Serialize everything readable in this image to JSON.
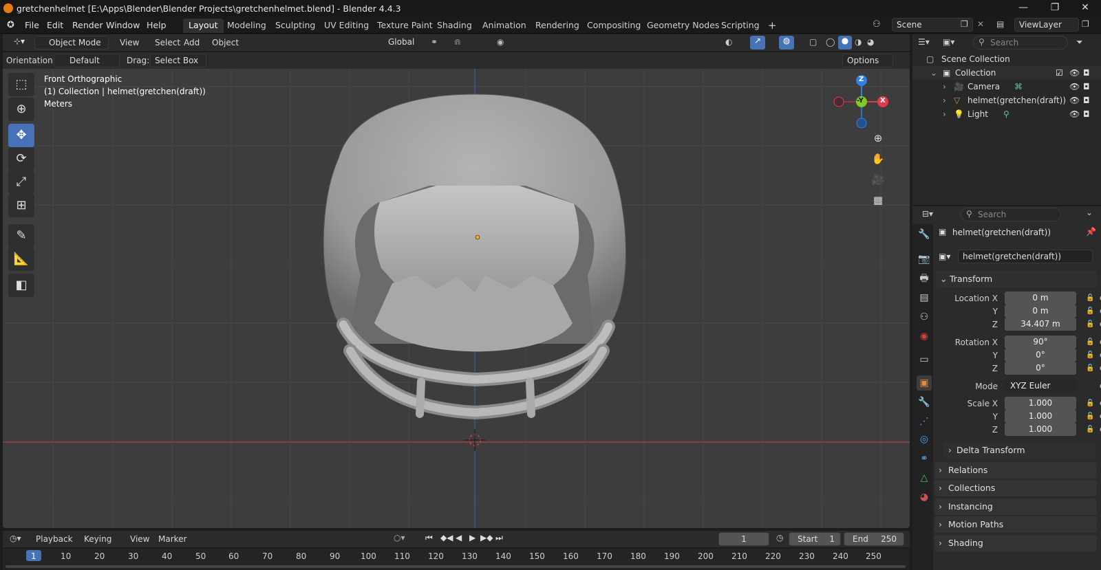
{
  "window": {
    "title": "gretchenhelmet [E:\\Apps\\Blender\\Blender Projects\\gretchenhelmet.blend] - Blender 4.4.3",
    "controls": [
      "—",
      "❐",
      "✕"
    ]
  },
  "menu": [
    "File",
    "Edit",
    "Render",
    "Window",
    "Help"
  ],
  "workspaces": [
    "Layout",
    "Modeling",
    "Sculpting",
    "UV Editing",
    "Texture Paint",
    "Shading",
    "Animation",
    "Rendering",
    "Compositing",
    "Geometry Nodes",
    "Scripting"
  ],
  "active_workspace": "Layout",
  "add_workspace": "+",
  "scene": {
    "name": "Scene",
    "view_layer": "ViewLayer"
  },
  "viewport_header": {
    "mode": "Object Mode",
    "menus": [
      "View",
      "Select",
      "Add",
      "Object"
    ],
    "transform": "Global"
  },
  "tool_settings": {
    "orientation_label": "Orientation:",
    "orientation_value": "Default",
    "drag_label": "Drag:",
    "drag_value": "Select Box",
    "options": "Options"
  },
  "overlay_text": {
    "view": "Front Orthographic",
    "collection": "(1) Collection | helmet(gretchen(draft))",
    "units": "Meters"
  },
  "gizmo": {
    "z": "Z",
    "x": "X",
    "y": "-Y"
  },
  "outliner": {
    "search_placeholder": "Search",
    "scene_collection": "Scene Collection",
    "collection": "Collection",
    "items": [
      "Camera",
      "helmet(gretchen(draft))",
      "Light"
    ]
  },
  "properties": {
    "search_placeholder": "Search",
    "object_name": "helmet(gretchen(draft))",
    "datablock": "helmet(gretchen(draft))",
    "transform_title": "Transform",
    "location": {
      "label": "Location X",
      "x": "0 m",
      "y": "0 m",
      "z": "34.407 m"
    },
    "rotation": {
      "label": "Rotation X",
      "x": "90°",
      "y": "0°",
      "z": "0°"
    },
    "mode_label": "Mode",
    "mode_value": "XYZ Euler",
    "scale": {
      "label": "Scale X",
      "x": "1.000",
      "y": "1.000",
      "z": "1.000"
    },
    "axis_y": "Y",
    "axis_z": "Z",
    "delta": "Delta Transform",
    "panels": [
      "Relations",
      "Collections",
      "Instancing",
      "Motion Paths",
      "Shading"
    ]
  },
  "timeline": {
    "menus": [
      "Playback",
      "Keying",
      "View",
      "Marker"
    ],
    "current_frame": "1",
    "start_label": "Start",
    "start": "1",
    "end_label": "End",
    "end": "250",
    "ticks": [
      "1",
      "10",
      "20",
      "30",
      "40",
      "50",
      "60",
      "70",
      "80",
      "90",
      "100",
      "110",
      "120",
      "130",
      "140",
      "150",
      "160",
      "170",
      "180",
      "190",
      "200",
      "210",
      "220",
      "230",
      "240",
      "250"
    ]
  },
  "colors": {
    "accent": "#4772b3",
    "x_axis": "#e23c4c",
    "y_axis": "#7ecb2a",
    "z_axis": "#2f83e0"
  }
}
